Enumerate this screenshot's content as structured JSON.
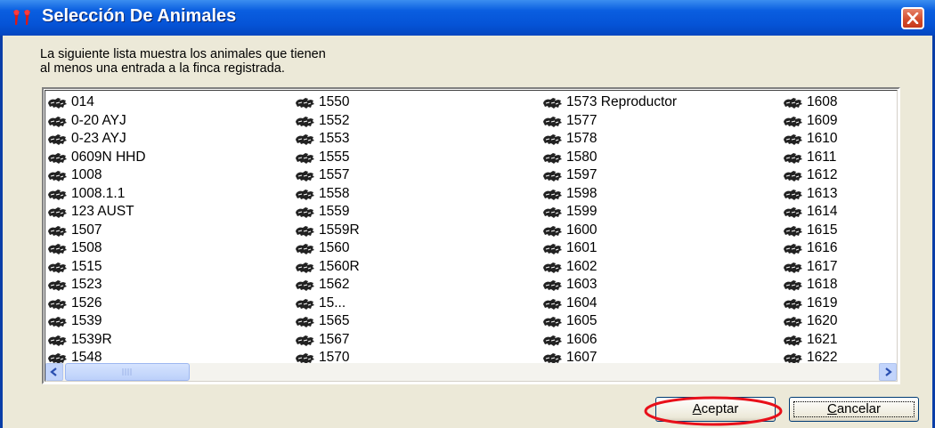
{
  "window": {
    "title": "Selección De Animales",
    "close_icon": "close-icon"
  },
  "description": {
    "line1": "La siguiente lista muestra los animales que tienen",
    "line2": "al menos una entrada a la finca registrada."
  },
  "list": {
    "item_icon": "animal-icon",
    "columns": [
      [
        "014",
        "0-20 AYJ",
        "0-23 AYJ",
        "0609N HHD",
        "1008",
        "1008.1.1",
        "123 AUST",
        "1507",
        "1508",
        "1515",
        "1523",
        "1526",
        "1539",
        "1539R",
        "1548"
      ],
      [
        "1550",
        "1552",
        "1553",
        "1555",
        "1557",
        "1558",
        "1559",
        "1559R",
        "1560",
        "1560R",
        "1562",
        "15...",
        "1565",
        "1567",
        "1570"
      ],
      [
        "1573 Reproductor",
        "1577",
        "1578",
        "1580",
        "1597",
        "1598",
        "1599",
        "1600",
        "1601",
        "1602",
        "1603",
        "1604",
        "1605",
        "1606",
        "1607"
      ],
      [
        "1608",
        "1609",
        "1610",
        "1611",
        "1612",
        "1613",
        "1614",
        "1615",
        "1616",
        "1617",
        "1618",
        "1619",
        "1620",
        "1621",
        "1622"
      ]
    ]
  },
  "buttons": {
    "accept_mnemonic": "A",
    "accept_rest": "ceptar",
    "cancel_mnemonic": "C",
    "cancel_rest": "ancelar"
  },
  "colors": {
    "titlebar": "#0553d6",
    "highlight": "#e8101a",
    "dialog_bg": "#ece9d8"
  }
}
